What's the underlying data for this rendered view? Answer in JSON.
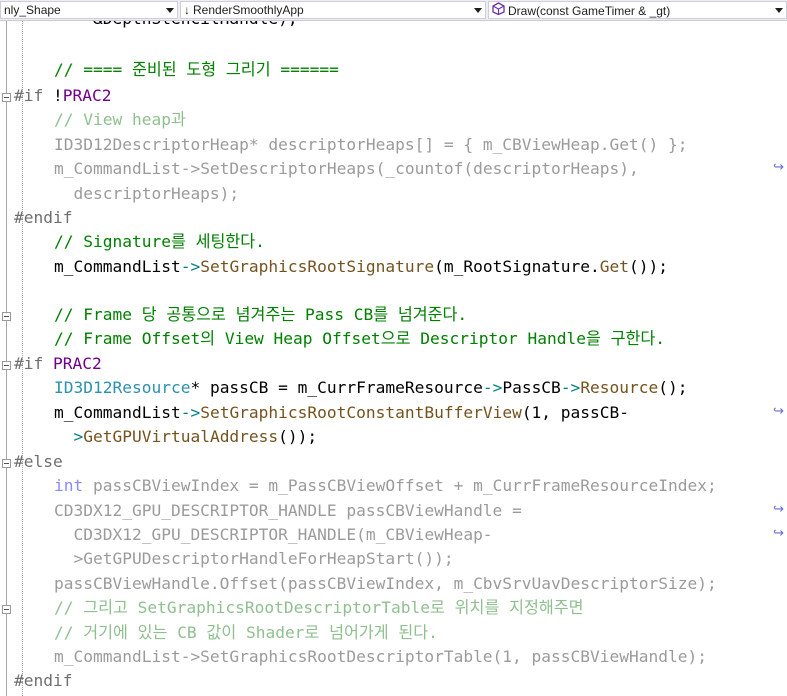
{
  "navbar": {
    "project_dropdown": "nly_Shape",
    "scope_dropdown": "RenderSmoothlyApp",
    "member_dropdown": "Draw(const GameTimer & _gt)",
    "scope_icon": "arrow-down-icon",
    "member_icon": "cube-method-icon"
  },
  "code": {
    "l1": "    &DepthStencilHandle);",
    "l2": "// ==== 준비된 도형 그리기 ======",
    "l3_pp": "#if ",
    "l3_op": "!",
    "l3_mac": "PRAC2",
    "l4": "// View heap과",
    "l5_ty": "ID3D12DescriptorHeap",
    "l5_rest": "* descriptorHeaps[] = { m_CBViewHeap.Get() };",
    "l6_a": "m_CommandList->",
    "l6_b": "SetDescriptorHeaps",
    "l6_c": "(_countof(descriptorHeaps),",
    "l7": "  descriptorHeaps);",
    "l8": "#endif",
    "l9": "// Signature를 세팅한다.",
    "l10_a": "m_CommandList",
    "l10_op": "->",
    "l10_fn": "SetGraphicsRootSignature",
    "l10_b": "(m_RootSignature.",
    "l10_fn2": "Get",
    "l10_c": "());",
    "l12": "// Frame 당 공통으로 념겨주는 Pass CB를 넘겨준다.",
    "l13": "// Frame Offset의 View Heap Offset으로 Descriptor Handle을 구한다.",
    "l14_pp": "#if ",
    "l14_mac": "PRAC2",
    "l15_ty": "ID3D12Resource",
    "l15_a": "* passCB = m_CurrFrameResource",
    "l15_op": "->",
    "l15_b": "PassCB",
    "l15_op2": "->",
    "l15_fn": "Resource",
    "l15_c": "();",
    "l16_a": "m_CommandList",
    "l16_op": "->",
    "l16_fn": "SetGraphicsRootConstantBufferView",
    "l16_b": "(1, passCB-",
    "l17_op": "  >",
    "l17_fn": "GetGPUVirtualAddress",
    "l17_b": "());",
    "l18": "#else",
    "l19_kw": "int",
    "l19_rest": " passCBViewIndex = m_PassCBViewOffset + m_CurrFrameResourceIndex;",
    "l20": "CD3DX12_GPU_DESCRIPTOR_HANDLE passCBViewHandle =",
    "l21": "  CD3DX12_GPU_DESCRIPTOR_HANDLE(m_CBViewHeap-",
    "l22": "  >GetGPUDescriptorHandleForHeapStart());",
    "l23": "passCBViewHandle.Offset(passCBViewIndex, m_CbvSrvUavDescriptorSize);",
    "l24": "// 그리고 SetGraphicsRootDescriptorTable로 위치를 지정해주면",
    "l25": "// 거기에 있는 CB 값이 Shader로 넘어가게 된다.",
    "l26": "m_CommandList->SetGraphicsRootDescriptorTable(1, passCBViewHandle);",
    "l27": "#endif"
  },
  "colors": {
    "keyword": "#0000ff",
    "macro": "#6f008a",
    "comment": "#008000",
    "type": "#2b91af",
    "function": "#74531f",
    "preprocessor": "#6f6f6f"
  }
}
